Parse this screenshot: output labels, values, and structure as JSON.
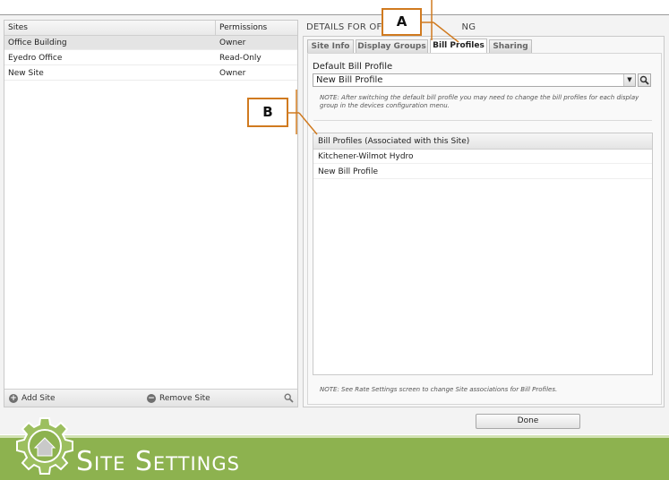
{
  "sites_panel": {
    "headers": {
      "sites": "Sites",
      "permissions": "Permissions"
    },
    "rows": [
      {
        "name": "Office Building",
        "permission": "Owner"
      },
      {
        "name": "Eyedro Office",
        "permission": "Read-Only"
      },
      {
        "name": "New Site",
        "permission": "Owner"
      }
    ],
    "footer": {
      "add_label": "Add Site",
      "remove_label": "Remove Site"
    }
  },
  "details": {
    "title_visible": "DETAILS FOR OFFI",
    "title_visible_end": "NG",
    "tabs": [
      {
        "label": "Site Info"
      },
      {
        "label": "Display Groups"
      },
      {
        "label": "Bill Profiles"
      },
      {
        "label": "Sharing"
      }
    ],
    "default_bill_profile_label": "Default Bill Profile",
    "default_bill_profile_value": "New Bill Profile",
    "note_top": "NOTE: After switching the default bill profile you may need to change the bill profiles for each display group in the devices configuration menu.",
    "table_header": "Bill Profiles (Associated with this Site)",
    "bill_profiles": [
      "Kitchener-Wilmot Hydro",
      "New Bill Profile"
    ],
    "note_bottom": "NOTE: See Rate Settings screen to change Site associations for Bill Profiles."
  },
  "done_label": "Done",
  "callouts": {
    "a": "A",
    "b": "B"
  },
  "banner": {
    "title": "Site Settings"
  },
  "colors": {
    "accent": "#d07a1f",
    "banner": "#8db24f"
  }
}
